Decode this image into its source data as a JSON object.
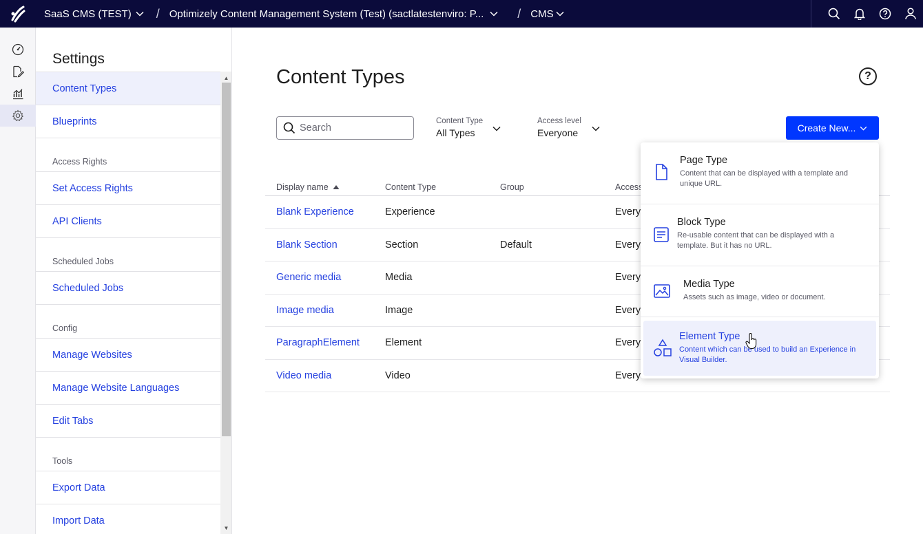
{
  "topbar": {
    "breadcrumbs": [
      {
        "label": "SaaS CMS (TEST)"
      },
      {
        "label": "Optimizely Content Management System (Test) (sactlatestenviro: P..."
      },
      {
        "label": "CMS"
      }
    ],
    "icons": [
      "search-icon",
      "bell-icon",
      "help-icon",
      "user-icon"
    ]
  },
  "rail": {
    "items": [
      "dashboard-icon",
      "edit-icon",
      "analytics-icon",
      "gear-icon"
    ],
    "active": "gear-icon"
  },
  "settings": {
    "title": "Settings",
    "items": [
      {
        "type": "item",
        "label": "Content Types",
        "active": true
      },
      {
        "type": "item",
        "label": "Blueprints"
      },
      {
        "type": "group",
        "label": "Access Rights"
      },
      {
        "type": "item",
        "label": "Set Access Rights"
      },
      {
        "type": "item",
        "label": "API Clients"
      },
      {
        "type": "group",
        "label": "Scheduled Jobs"
      },
      {
        "type": "item",
        "label": "Scheduled Jobs"
      },
      {
        "type": "group",
        "label": "Config"
      },
      {
        "type": "item",
        "label": "Manage Websites"
      },
      {
        "type": "item",
        "label": "Manage Website Languages"
      },
      {
        "type": "item",
        "label": "Edit Tabs"
      },
      {
        "type": "group",
        "label": "Tools"
      },
      {
        "type": "item",
        "label": "Export Data"
      },
      {
        "type": "item",
        "label": "Import Data"
      }
    ]
  },
  "main": {
    "title": "Content Types",
    "help": "?",
    "search": {
      "placeholder": "Search",
      "value": ""
    },
    "filters": [
      {
        "label": "Content Type",
        "value": "All Types"
      },
      {
        "label": "Access level",
        "value": "Everyone"
      }
    ],
    "create_label": "Create New...",
    "table": {
      "headers": [
        "Display name",
        "Content Type",
        "Group",
        "Access"
      ],
      "rows": [
        [
          "Blank Experience",
          "Experience",
          "",
          "Every"
        ],
        [
          "Blank Section",
          "Section",
          "Default",
          "Every"
        ],
        [
          "Generic media",
          "Media",
          "",
          "Every"
        ],
        [
          "Image media",
          "Image",
          "",
          "Every"
        ],
        [
          "ParagraphElement",
          "Element",
          "",
          "Every"
        ],
        [
          "Video media",
          "Video",
          "",
          "Every"
        ]
      ]
    }
  },
  "dropdown": {
    "items": [
      {
        "title": "Page Type",
        "desc": "Content that can be displayed with a template and unique URL.",
        "icon": "page-icon"
      },
      {
        "title": "Block Type",
        "desc": "Re-usable content that can be displayed with a template. But it has no URL.",
        "icon": "block-icon"
      },
      {
        "title": "Media Type",
        "desc": "Assets such as image, video or document.",
        "icon": "image-icon"
      },
      {
        "title": "Element Type",
        "desc": "Content which can be used to build an Experience in Visual Builder.",
        "icon": "shapes-icon",
        "hover": true
      }
    ]
  },
  "colors": {
    "topbar": "#0b0b3b",
    "accent": "#0037ff",
    "link": "#2541e0"
  }
}
